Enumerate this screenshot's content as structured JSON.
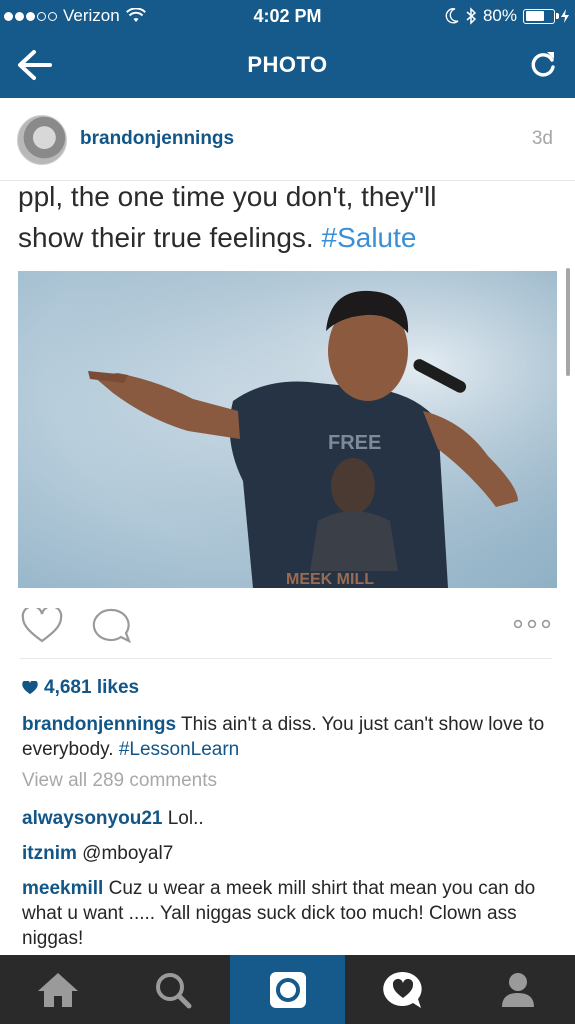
{
  "status_bar": {
    "carrier": "Verizon",
    "time": "4:02 PM",
    "battery": "80%",
    "battery_level": 0.8
  },
  "nav": {
    "title": "PHOTO",
    "back_icon": "arrow-left-icon",
    "refresh_icon": "refresh-icon"
  },
  "post": {
    "username": "brandonjennings",
    "age": "3d",
    "photo_text_line1": "ppl, the one time you don't, they\"ll",
    "photo_text_line2": "show their true feelings.",
    "photo_text_hashtag": "#Salute",
    "photo_shirt_text_top": "FREE",
    "photo_shirt_text_bottom": "MEEK MILL"
  },
  "actions": {
    "like_icon": "heart-icon",
    "comment_icon": "comment-icon",
    "more_icon": "more-icon"
  },
  "likes": {
    "count_label": "4,681 likes"
  },
  "caption": {
    "username": "brandonjennings",
    "text": " This ain't a diss. You just can't show love to everybody. ",
    "hashtag": "#LessonLearn"
  },
  "view_all_comments": "View all 289 comments",
  "comments": [
    {
      "username": "alwaysonyou21",
      "text": " Lol.."
    },
    {
      "username": "itznim",
      "text": " @mboyal7"
    },
    {
      "username": "meekmill",
      "text": " Cuz u wear a meek mill shirt that mean you can do what u want ..... Yall niggas suck dick too much! Clown ass niggas!"
    }
  ],
  "tabbar": {
    "tabs": [
      {
        "icon": "home-icon",
        "active": false
      },
      {
        "icon": "search-icon",
        "active": false
      },
      {
        "icon": "camera-icon",
        "active": true
      },
      {
        "icon": "activity-icon",
        "active": false
      },
      {
        "icon": "profile-icon",
        "active": false
      }
    ],
    "active_color": "#155a8a",
    "background_color": "#2a2a2a"
  },
  "colors": {
    "header": "#155a8a",
    "username": "#125688",
    "hashtag_in_photo": "#3b8fd6",
    "muted": "#a8a8a8"
  }
}
